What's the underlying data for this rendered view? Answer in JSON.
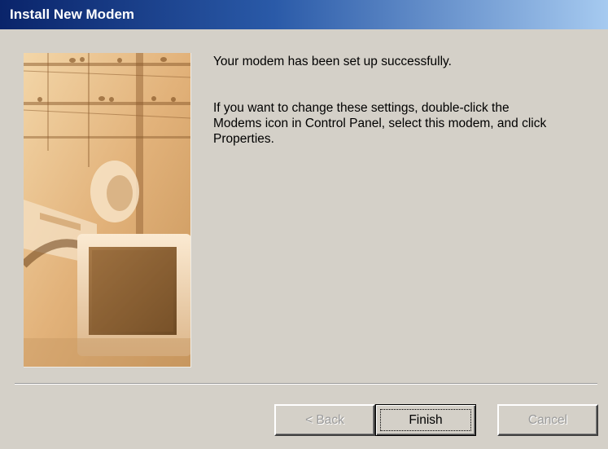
{
  "window": {
    "title": "Install New Modem"
  },
  "message": {
    "line1": "Your modem has been set up successfully.",
    "line2": "If you want to change these settings, double-click the Modems icon in Control Panel, select this modem, and click Properties."
  },
  "buttons": {
    "back_label": "< Back",
    "finish_label": "Finish",
    "cancel_label": "Cancel"
  },
  "colors": {
    "titlebar_start": "#0a246a",
    "titlebar_end": "#a6caf0",
    "face": "#d4d0c8",
    "disabled_text": "#9a9a9a"
  },
  "illustration": {
    "icon": "modem-wizard-illustration"
  }
}
